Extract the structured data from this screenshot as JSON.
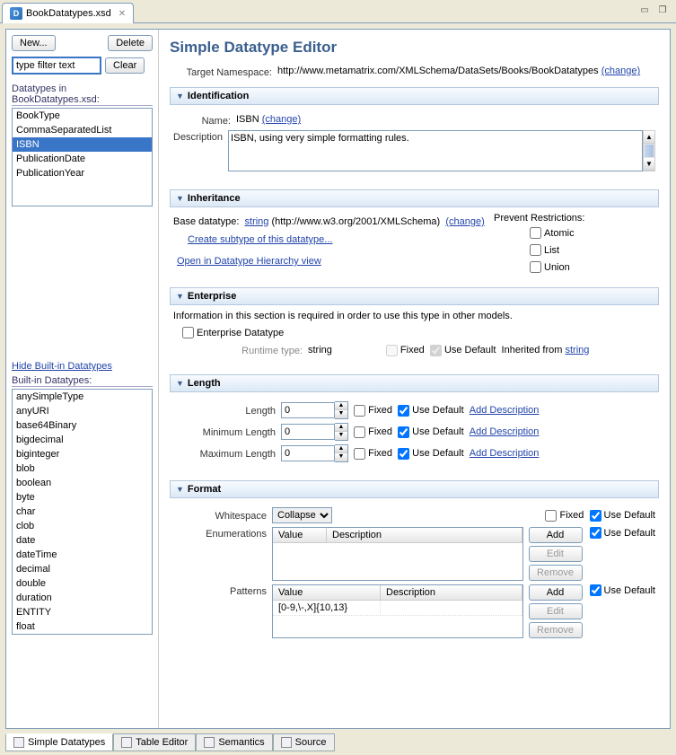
{
  "tab": {
    "title": "BookDatatypes.xsd"
  },
  "left": {
    "new_btn": "New...",
    "delete_btn": "Delete",
    "filter_placeholder": "type filter text",
    "clear_btn": "Clear",
    "datatypes_header": "Datatypes in BookDatatypes.xsd:",
    "datatypes": [
      "BookType",
      "CommaSeparatedList",
      "ISBN",
      "PublicationDate",
      "PublicationYear"
    ],
    "selected_datatype": "ISBN",
    "hide_builtin_link": "Hide Built-in Datatypes",
    "builtin_header": "Built-in Datatypes:",
    "builtin": [
      "anySimpleType",
      "anyURI",
      "base64Binary",
      "bigdecimal",
      "biginteger",
      "blob",
      "boolean",
      "byte",
      "char",
      "clob",
      "date",
      "dateTime",
      "decimal",
      "double",
      "duration",
      "ENTITY",
      "float"
    ]
  },
  "editor": {
    "title": "Simple Datatype Editor",
    "ns_label": "Target Namespace:",
    "ns_value": "http://www.metamatrix.com/XMLSchema/DataSets/Books/BookDatatypes",
    "change_link": "(change)"
  },
  "ident": {
    "header": "Identification",
    "name_label": "Name:",
    "name_value": "ISBN",
    "desc_label": "Description",
    "desc_value": "ISBN, using very simple formatting rules."
  },
  "inherit": {
    "header": "Inheritance",
    "base_label": "Base datatype:",
    "base_link": "string",
    "base_ns": "(http://www.w3.org/2001/XMLSchema)",
    "create_sub_link": "Create subtype of this datatype...",
    "open_hier_link": "Open in Datatype Hierarchy view",
    "prevent_label": "Prevent Restrictions:",
    "atomic": "Atomic",
    "list": "List",
    "union": "Union"
  },
  "enterprise": {
    "header": "Enterprise",
    "info": "Information in this section is required in order to use this type in other models.",
    "checkbox": "Enterprise Datatype",
    "runtime_label": "Runtime type:",
    "runtime_value": "string",
    "fixed": "Fixed",
    "use_default": "Use Default",
    "inherited_label": "Inherited from",
    "inherited_link": "string"
  },
  "length": {
    "header": "Length",
    "length_label": "Length",
    "min_label": "Minimum Length",
    "max_label": "Maximum Length",
    "value": "0",
    "fixed": "Fixed",
    "use_default": "Use Default",
    "add_desc": "Add Description"
  },
  "format": {
    "header": "Format",
    "ws_label": "Whitespace",
    "ws_value": "Collapse",
    "enum_label": "Enumerations",
    "pattern_label": "Patterns",
    "col_value": "Value",
    "col_desc": "Description",
    "pattern_value": "[0-9,\\-,X]{10,13}",
    "add": "Add",
    "edit": "Edit",
    "remove": "Remove",
    "fixed": "Fixed",
    "use_default": "Use Default"
  },
  "bottom_tabs": [
    "Simple Datatypes",
    "Table Editor",
    "Semantics",
    "Source"
  ]
}
